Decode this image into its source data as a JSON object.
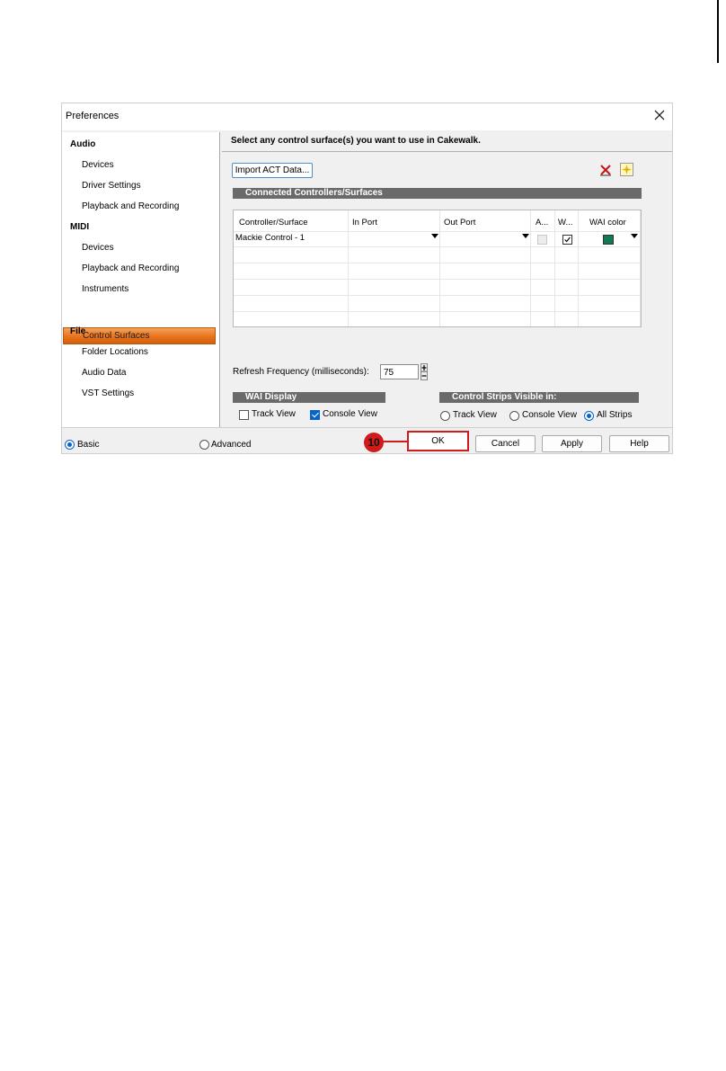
{
  "window": {
    "title": "Preferences"
  },
  "nav": {
    "groups": [
      {
        "label": "Audio",
        "items": [
          "Devices",
          "Driver Settings",
          "Playback and Recording"
        ]
      },
      {
        "label": "MIDI",
        "items": [
          "Devices",
          "Playback and Recording",
          "Instruments",
          "Control Surfaces"
        ]
      },
      {
        "label": "File",
        "items": [
          "Folder Locations",
          "Audio Data",
          "VST Settings"
        ]
      }
    ],
    "selected": "Control Surfaces"
  },
  "content": {
    "header": "Select any control surface(s) you want to use in Cakewalk.",
    "import_button": "Import ACT Data...",
    "connected_section": "Connected Controllers/Surfaces",
    "columns": [
      "Controller/Surface",
      "In Port",
      "Out Port",
      "A...",
      "W...",
      "WAI color"
    ],
    "rows": [
      {
        "controller": "Mackie Control - 1",
        "in_port": "",
        "out_port": "",
        "a_checked": false,
        "w_checked": true,
        "wai_color": "#117a52"
      }
    ],
    "refresh_label": "Refresh Frequency (milliseconds):",
    "refresh_value": "75",
    "wai_display": {
      "title": "WAI Display",
      "track_view": "Track View",
      "track_view_checked": false,
      "console_view": "Console View",
      "console_view_checked": true
    },
    "strips_visible": {
      "title": "Control Strips Visible in:",
      "track_view": "Track View",
      "console_view": "Console View",
      "all_strips": "All Strips",
      "selected": "All Strips"
    }
  },
  "footer": {
    "mode_basic": "Basic",
    "mode_advanced": "Advanced",
    "mode_selected": "Basic",
    "ok": "OK",
    "cancel": "Cancel",
    "apply": "Apply",
    "help": "Help"
  },
  "callout": {
    "number": "10"
  },
  "colors": {
    "highlight": "#d21a1a",
    "selection": "#e8731c",
    "accent": "#0a64c8"
  }
}
